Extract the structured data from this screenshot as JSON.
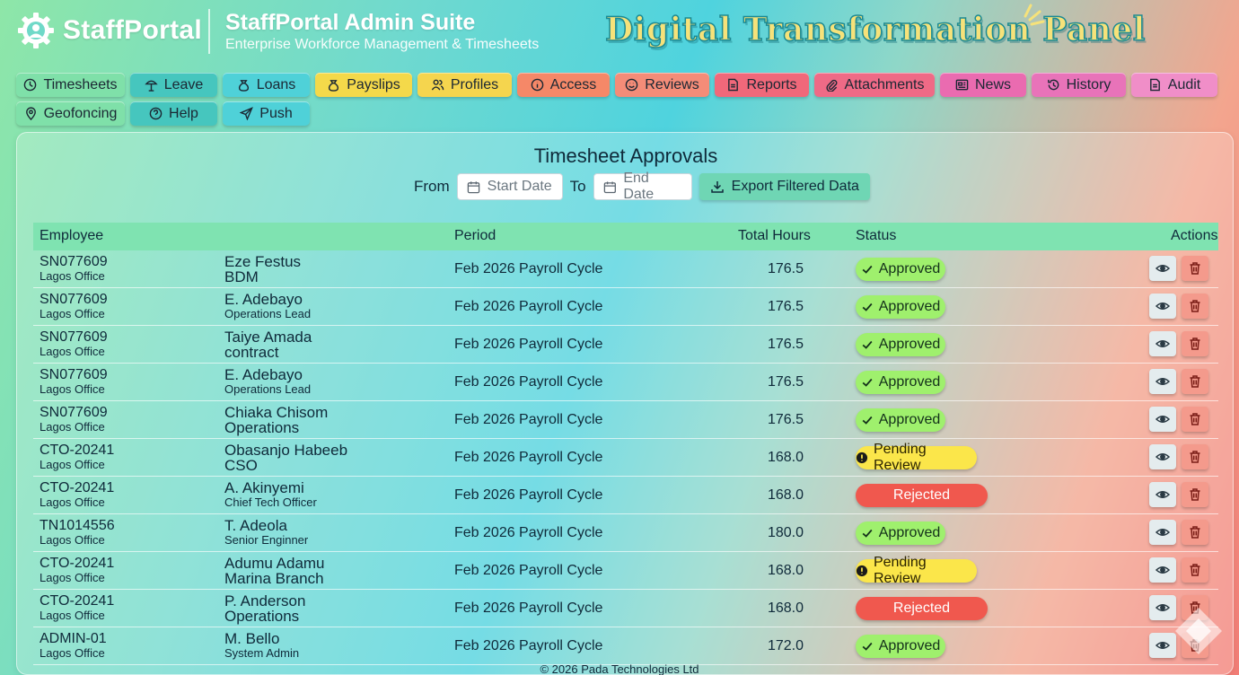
{
  "brand": {
    "name": "StaffPortal",
    "suite_title": "StaffPortal Admin Suite",
    "suite_subtitle": "Enterprise Workforce Management & Timesheets",
    "banner": "Digital Transformation Panel"
  },
  "nav": {
    "row1": [
      {
        "label": "Timesheets",
        "icon": "clock-icon",
        "color": "#7fe0a9"
      },
      {
        "label": "Leave",
        "icon": "beach-umbrella-icon",
        "color": "#46c6be"
      },
      {
        "label": "Loans",
        "icon": "money-bag-icon",
        "color": "#4fd1d8"
      },
      {
        "label": "Payslips",
        "icon": "money-bag-icon",
        "color": "#f4d94a"
      },
      {
        "label": "Profiles",
        "icon": "users-icon",
        "color": "#f5d54e"
      },
      {
        "label": "Access",
        "icon": "info-icon",
        "color": "#f58868"
      },
      {
        "label": "Reviews",
        "icon": "smiley-icon",
        "color": "#f48c78"
      },
      {
        "label": "Reports",
        "icon": "document-icon",
        "color": "#f0687a"
      },
      {
        "label": "Attachments",
        "icon": "paperclip-icon",
        "color": "#ef6a86"
      },
      {
        "label": "News",
        "icon": "newspaper-icon",
        "color": "#ea6bb0"
      },
      {
        "label": "History",
        "icon": "history-icon",
        "color": "#e873b9"
      },
      {
        "label": "Audit",
        "icon": "document-icon",
        "color": "#f08ec8"
      }
    ],
    "row2": [
      {
        "label": "Geofoncing",
        "icon": "location-pin-icon",
        "color": "#7fe0a9"
      },
      {
        "label": "Help",
        "icon": "help-icon",
        "color": "#46c6be"
      },
      {
        "label": "Push",
        "icon": "send-icon",
        "color": "#4fd1d8"
      }
    ]
  },
  "panel": {
    "title": "Timesheet Approvals",
    "from_label": "From",
    "to_label": "To",
    "start_placeholder": "Start Date",
    "end_placeholder": "End Date",
    "export_label": "Export Filtered Data"
  },
  "table": {
    "headers": {
      "employee": "Employee",
      "period": "Period",
      "hours": "Total Hours",
      "status": "Status",
      "actions": "Actions"
    },
    "rows": [
      {
        "id": "SN077609",
        "office": "Lagos Office",
        "name": "Eze Festus",
        "role": "BDM",
        "role_big": true,
        "period": "Feb 2026 Payroll Cycle",
        "hours": "176.5",
        "status": "Approved",
        "status_type": "approved"
      },
      {
        "id": "SN077609",
        "office": "Lagos Office",
        "name": "E. Adebayo",
        "role": "Operations Lead",
        "role_big": false,
        "period": "Feb 2026 Payroll Cycle",
        "hours": "176.5",
        "status": "Approved",
        "status_type": "approved"
      },
      {
        "id": "SN077609",
        "office": "Lagos Office",
        "name": "Taiye Amada",
        "role": "contract",
        "role_big": true,
        "period": "Feb 2026 Payroll Cycle",
        "hours": "176.5",
        "status": "Approved",
        "status_type": "approved"
      },
      {
        "id": "SN077609",
        "office": "Lagos Office",
        "name": "E. Adebayo",
        "role": "Operations Lead",
        "role_big": false,
        "period": "Feb 2026 Payroll Cycle",
        "hours": "176.5",
        "status": "Approved",
        "status_type": "approved"
      },
      {
        "id": "SN077609",
        "office": "Lagos Office",
        "name": "Chiaka Chisom",
        "role": "Operations",
        "role_big": true,
        "period": "Feb 2026 Payroll Cycle",
        "hours": "176.5",
        "status": "Approved",
        "status_type": "approved"
      },
      {
        "id": "CTO-20241",
        "office": "Lagos Office",
        "name": "Obasanjo Habeeb",
        "role": "CSO",
        "role_big": true,
        "period": "Feb 2026 Payroll Cycle",
        "hours": "168.0",
        "status": "Pending Review",
        "status_type": "pending"
      },
      {
        "id": "CTO-20241",
        "office": "Lagos Office",
        "name": "A. Akinyemi",
        "role": "Chief Tech Officer",
        "role_big": false,
        "period": "Feb 2026 Payroll Cycle",
        "hours": "168.0",
        "status": "Rejected",
        "status_type": "rejected"
      },
      {
        "id": "TN1014556",
        "office": "Lagos Office",
        "name": "T. Adeola",
        "role": "Senior Enginner",
        "role_big": false,
        "period": "Feb 2026 Payroll Cycle",
        "hours": "180.0",
        "status": "Approved",
        "status_type": "approved"
      },
      {
        "id": "CTO-20241",
        "office": "Lagos Office",
        "name": "Adumu Adamu",
        "role": "Marina Branch",
        "role_big": true,
        "period": "Feb 2026 Payroll Cycle",
        "hours": "168.0",
        "status": "Pending Review",
        "status_type": "pending"
      },
      {
        "id": "CTO-20241",
        "office": "Lagos Office",
        "name": "P. Anderson",
        "role": "Operations",
        "role_big": true,
        "period": "Feb 2026 Payroll Cycle",
        "hours": "168.0",
        "status": "Rejected",
        "status_type": "rejected"
      },
      {
        "id": "ADMIN-01",
        "office": "Lagos Office",
        "name": "M. Bello",
        "role": "System Admin",
        "role_big": false,
        "period": "Feb 2026 Payroll Cycle",
        "hours": "172.0",
        "status": "Approved",
        "status_type": "approved"
      }
    ]
  },
  "footer": "© 2026 Pada Technologies Ltd"
}
